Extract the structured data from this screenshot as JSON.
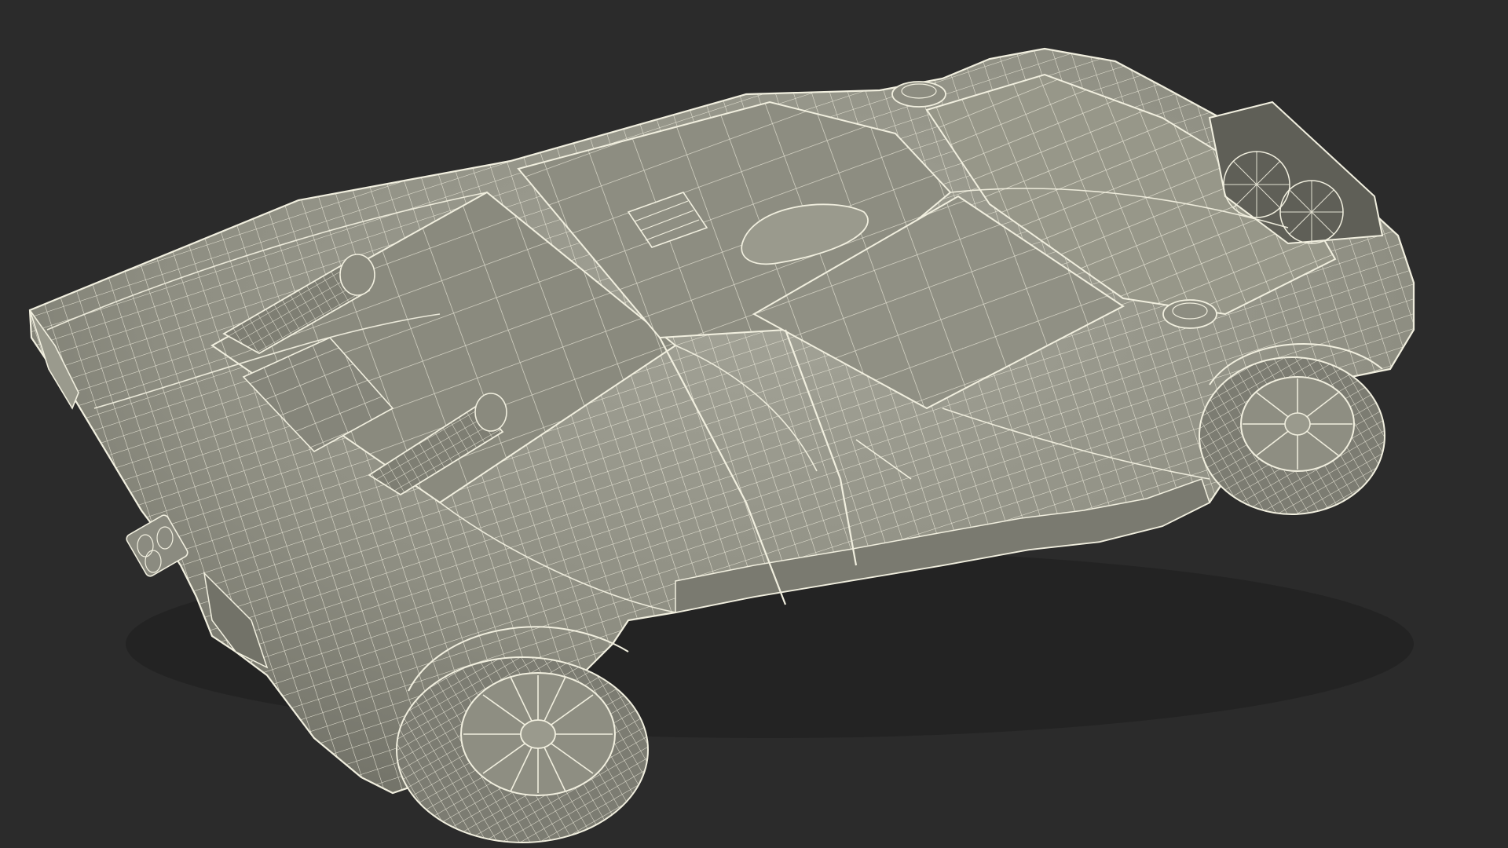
{
  "scene": {
    "subject": "car-wireframe-render",
    "view": "rear-three-quarter-top",
    "colors": {
      "background": "#2b2b2b",
      "body_fill": "#8e8e82",
      "body_fill_dark": "#6f6f65",
      "body_fill_light": "#a3a397",
      "wire": "#f1efdf",
      "wire_faint": "#cfcdbd",
      "tire_fill": "#7c7c72",
      "shadow": "#1e1e1e"
    },
    "components": [
      "rear-deck",
      "roof",
      "windshield",
      "front-hood",
      "front-grille",
      "rear-wing-edge",
      "exhaust",
      "front-wheel",
      "rear-wheel",
      "fuel-caps",
      "air-scoops",
      "door-line"
    ]
  }
}
